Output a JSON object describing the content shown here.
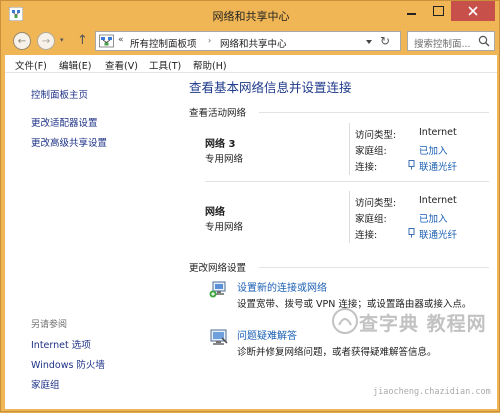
{
  "window": {
    "title": "网络和共享中心"
  },
  "nav": {
    "back_glyph": "←",
    "forward_glyph": "→",
    "history_glyph": "▾",
    "up_glyph": "↑",
    "address_prefix": "«",
    "breadcrumb": [
      "所有控制面板项",
      "网络和共享中心"
    ],
    "breadcrumb_separator": "›",
    "refresh_glyph": "↻",
    "search_placeholder": "搜索控制面..."
  },
  "menu": {
    "items": [
      "文件(F)",
      "编辑(E)",
      "查看(V)",
      "工具(T)",
      "帮助(H)"
    ]
  },
  "sidebar": {
    "links_top": [
      "控制面板主页",
      "更改适配器设置",
      "更改高级共享设置"
    ],
    "see_also_heading": "另请参阅",
    "links_bottom": [
      "Internet 选项",
      "Windows 防火墙",
      "家庭组"
    ]
  },
  "main": {
    "title": "查看基本网络信息并设置连接",
    "active_networks_heading": "查看活动网络",
    "networks": [
      {
        "name": "网络  3",
        "type": "专用网络",
        "access_type_label": "访问类型:",
        "access_type_value": "Internet",
        "homegroup_label": "家庭组:",
        "homegroup_value": "已加入",
        "connection_label": "连接:",
        "connection_value": "联通光纤"
      },
      {
        "name": "网络",
        "type": "专用网络",
        "access_type_label": "访问类型:",
        "access_type_value": "Internet",
        "homegroup_label": "家庭组:",
        "homegroup_value": "已加入",
        "connection_label": "连接:",
        "connection_value": "联通光纤"
      }
    ],
    "change_settings_heading": "更改网络设置",
    "tasks": [
      {
        "label": "设置新的连接或网络",
        "description": "设置宽带、拨号或 VPN 连接；或设置路由器或接入点。",
        "icon": "new-connection-icon"
      },
      {
        "label": "问题疑难解答",
        "description": "诊断并修复网络问题，或者获得疑难解答信息。",
        "icon": "troubleshoot-icon"
      }
    ]
  },
  "watermark": {
    "text": "查字典 教程网",
    "url": "jiaocheng.chazidian.com"
  },
  "colors": {
    "accent_frame": "#f0b655",
    "link": "#1a5fb4",
    "title_blue": "#1e3a8a",
    "close_red": "#c7504b"
  }
}
